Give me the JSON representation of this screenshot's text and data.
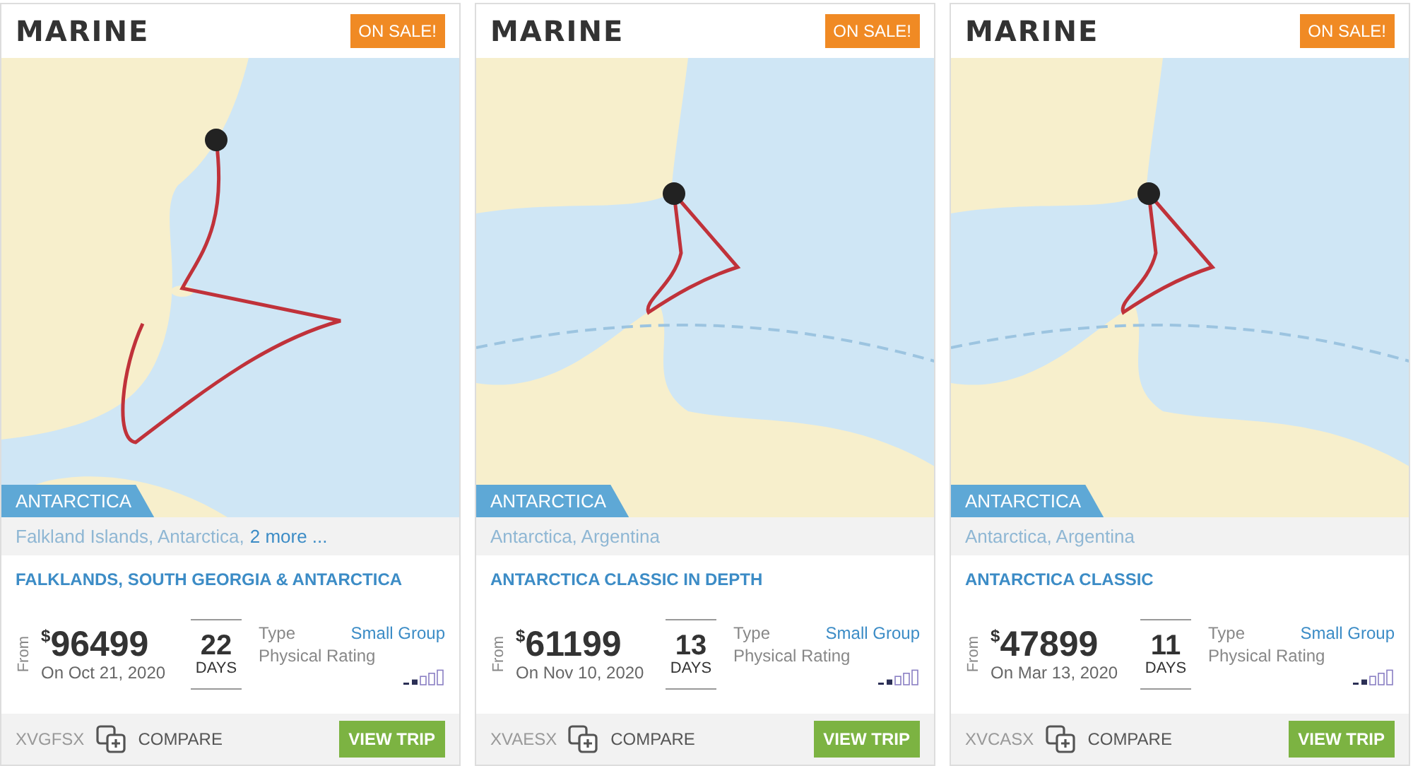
{
  "trips": [
    {
      "brand": "MARINE",
      "badge": "ON SALE!",
      "region_tag": "ANTARCTICA",
      "locations": "Falkland Islands, Antarctica,",
      "more_link": "2 more ...",
      "title": "FALKLANDS, SOUTH GEORGIA & ANTARCTICA",
      "from_label": "From",
      "currency": "$",
      "price": "96499",
      "date": "On Oct 21, 2020",
      "days": "22",
      "days_label": "DAYS",
      "type_label": "Type",
      "type_value": "Small Group",
      "rating_label": "Physical Rating",
      "rating": {
        "level": 0.4
      },
      "code": "XVGFSX",
      "compare_label": "COMPARE",
      "view_button": "VIEW TRIP"
    },
    {
      "brand": "MARINE",
      "badge": "ON SALE!",
      "region_tag": "ANTARCTICA",
      "locations": "Antarctica, Argentina",
      "title": "ANTARCTICA CLASSIC IN DEPTH",
      "from_label": "From",
      "currency": "$",
      "price": "61199",
      "date": "On Nov 10, 2020",
      "days": "13",
      "days_label": "DAYS",
      "type_label": "Type",
      "type_value": "Small Group",
      "rating_label": "Physical Rating",
      "rating": {
        "level": 0.4
      },
      "code": "XVAESX",
      "compare_label": "COMPARE",
      "view_button": "VIEW TRIP"
    },
    {
      "brand": "MARINE",
      "badge": "ON SALE!",
      "region_tag": "ANTARCTICA",
      "locations": "Antarctica, Argentina",
      "title": "ANTARCTICA CLASSIC",
      "from_label": "From",
      "currency": "$",
      "price": "47899",
      "date": "On Mar 13, 2020",
      "days": "11",
      "days_label": "DAYS",
      "type_label": "Type",
      "type_value": "Small Group",
      "rating_label": "Physical Rating",
      "rating": {
        "level": 0.4
      },
      "code": "XVCASX",
      "compare_label": "COMPARE",
      "view_button": "VIEW TRIP"
    }
  ]
}
